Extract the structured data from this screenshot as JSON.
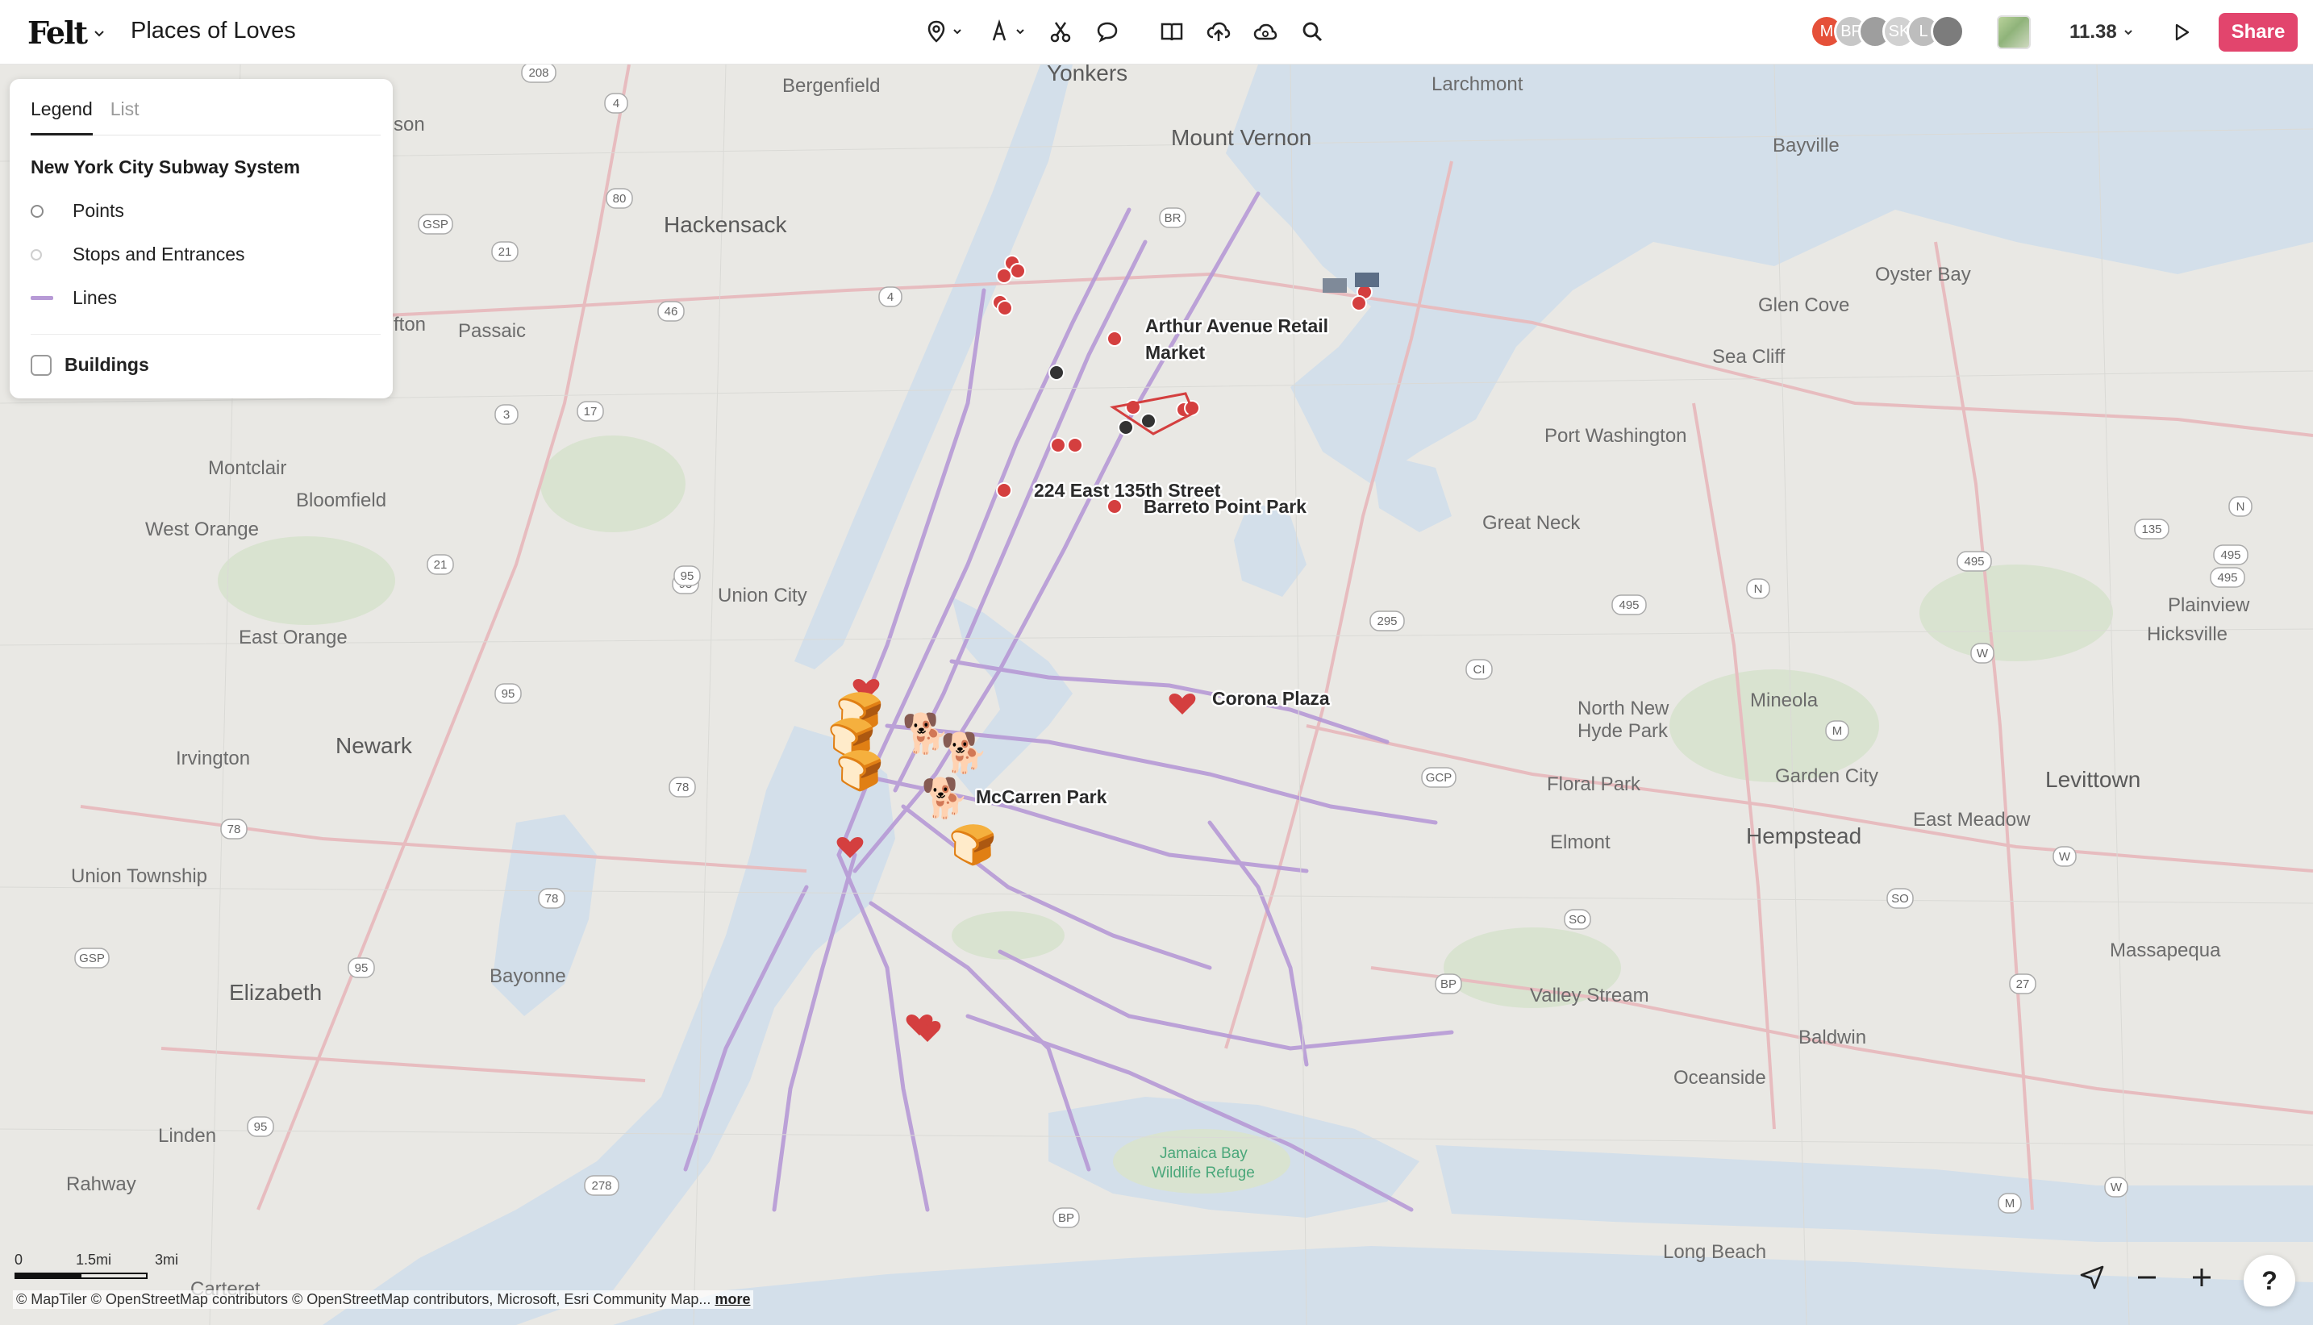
{
  "app": {
    "logo_text": "Felt",
    "title": "Places of Loves"
  },
  "toolbar": {
    "tools": [
      {
        "name": "pin-tool",
        "icon": "map-pin-icon"
      },
      {
        "name": "text-tool",
        "icon": "text-icon"
      },
      {
        "name": "route-tool",
        "icon": "scissors-route-icon"
      },
      {
        "name": "note-tool",
        "icon": "speech-bubble-icon"
      },
      {
        "name": "library-tool",
        "icon": "book-icon"
      },
      {
        "name": "upload-tool",
        "icon": "cloud-upload-icon"
      },
      {
        "name": "data-tool",
        "icon": "cloud-data-icon"
      },
      {
        "name": "search-tool",
        "icon": "search-icon"
      }
    ]
  },
  "collaborators": [
    {
      "initials": "M",
      "color": "#e55039"
    },
    {
      "initials": "BF",
      "color": "#c7c7c7"
    },
    {
      "initials": "",
      "color": "#9e9e9e"
    },
    {
      "initials": "SK",
      "color": "#d1d1d1"
    },
    {
      "initials": "L",
      "color": "#bdbdbd"
    },
    {
      "initials": "",
      "color": "#7c7c7c"
    }
  ],
  "zoom_level": "11.38",
  "share_label": "Share",
  "legend": {
    "tabs": [
      "Legend",
      "List"
    ],
    "active_tab": "Legend",
    "group_title": "New York City Subway System",
    "items": [
      {
        "label": "Points",
        "symbol": "circle"
      },
      {
        "label": "Stops and Entrances",
        "symbol": "faint-circle"
      },
      {
        "label": "Lines",
        "symbol": "line",
        "color": "#b79ad6"
      }
    ],
    "extra_layer": {
      "label": "Buildings",
      "checked": false
    }
  },
  "map": {
    "colors": {
      "land": "#e9e8e4",
      "water": "#d3dfea",
      "park": "#d9e3d0",
      "subway": "#b79ad6",
      "highway": "#e7bcbf",
      "pin": "#d43f3f"
    },
    "place_labels": [
      {
        "t": "Yonkers",
        "big": true
      },
      {
        "t": "Bergenfield"
      },
      {
        "t": "Larchmont"
      },
      {
        "t": "Mount Vernon",
        "big": true
      },
      {
        "t": "Bayville"
      },
      {
        "t": "Hackensack",
        "big": true
      },
      {
        "t": "Oyster Bay"
      },
      {
        "t": "Glen Cove"
      },
      {
        "t": "Sea Cliff"
      },
      {
        "t": "Passaic"
      },
      {
        "t": "Port Washington"
      },
      {
        "t": "Montclair"
      },
      {
        "t": "Bloomfield"
      },
      {
        "t": "Great Neck"
      },
      {
        "t": "West Orange"
      },
      {
        "t": "Plainview"
      },
      {
        "t": "Union City"
      },
      {
        "t": "Hicksville"
      },
      {
        "t": "East Orange"
      },
      {
        "t": "Mineola"
      },
      {
        "t": "North New"
      },
      {
        "t": "Hyde Park"
      },
      {
        "t": "Newark",
        "big": true
      },
      {
        "t": "Irvington"
      },
      {
        "t": "Floral Park"
      },
      {
        "t": "Garden City"
      },
      {
        "t": "Levittown",
        "big": true
      },
      {
        "t": "East Meadow"
      },
      {
        "t": "Elmont"
      },
      {
        "t": "Hempstead",
        "big": true
      },
      {
        "t": "Union Township"
      },
      {
        "t": "Bayonne"
      },
      {
        "t": "Elizabeth",
        "big": true
      },
      {
        "t": "Massapequa"
      },
      {
        "t": "Valley Stream"
      },
      {
        "t": "Baldwin"
      },
      {
        "t": "Oceanside"
      },
      {
        "t": "Linden"
      },
      {
        "t": "Rahway"
      },
      {
        "t": "Long Beach"
      },
      {
        "t": "Carteret"
      },
      {
        "t": "son"
      },
      {
        "t": "fton"
      }
    ],
    "water_label": [
      "Jamaica Bay",
      "Wildlife Refuge"
    ],
    "road_shields": [
      "208",
      "4",
      "80",
      "GSP",
      "21",
      "46",
      "4",
      "95",
      "17",
      "3",
      "21",
      "95",
      "95",
      "78",
      "78",
      "78",
      "GSP",
      "95",
      "95",
      "278",
      "BR",
      "295",
      "495",
      "495",
      "GCP",
      "CI",
      "135",
      "495",
      "N",
      "495",
      "N",
      "M",
      "W",
      "SO",
      "SO",
      "BP",
      "27",
      "W",
      "BP",
      "M",
      "W"
    ],
    "pin_labels": [
      {
        "t": "Arthur Avenue Retail"
      },
      {
        "t": "Market"
      },
      {
        "t": "224 East 135th Street"
      },
      {
        "t": "Barreto Point Park"
      },
      {
        "t": "Corona Plaza"
      },
      {
        "t": "McCarren Park"
      }
    ],
    "emoji_markers": [
      "🍞",
      "🍞",
      "🍞",
      "🍞",
      "🐕",
      "🐕",
      "🐕"
    ]
  },
  "scale": {
    "labels": [
      "0",
      "1.5mi",
      "3mi"
    ]
  },
  "attribution": {
    "text": "© MapTiler  © OpenStreetMap contributors  © OpenStreetMap contributors, Microsoft, Esri Community Map...",
    "more": "more"
  },
  "help_label": "?"
}
